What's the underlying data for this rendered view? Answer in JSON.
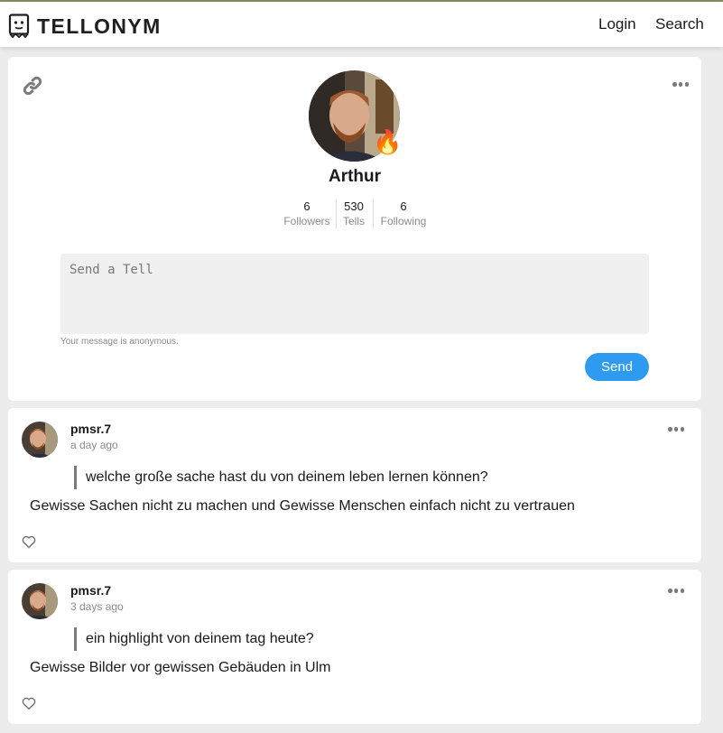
{
  "header": {
    "logo_text": "TELLONYM",
    "nav": {
      "login": "Login",
      "search": "Search"
    }
  },
  "profile": {
    "name": "Arthur",
    "badge_icon": "fire-icon",
    "stats": [
      {
        "value": "6",
        "label": "Followers"
      },
      {
        "value": "530",
        "label": "Tells"
      },
      {
        "value": "6",
        "label": "Following"
      }
    ],
    "tell_placeholder": "Send a Tell",
    "anon_note": "Your message is anonymous.",
    "send_label": "Send",
    "accent_color": "#2e9bf0"
  },
  "posts": [
    {
      "username": "pmsr.7",
      "time": "a day ago",
      "question": "welche große sache hast du von deinem leben lernen können?",
      "answer": "Gewisse Sachen nicht zu machen und Gewisse Menschen einfach nicht zu vertrauen"
    },
    {
      "username": "pmsr.7",
      "time": "3 days ago",
      "question": "ein highlight von deinem tag heute?",
      "answer": "Gewisse Bilder vor gewissen Gebäuden in Ulm"
    }
  ]
}
